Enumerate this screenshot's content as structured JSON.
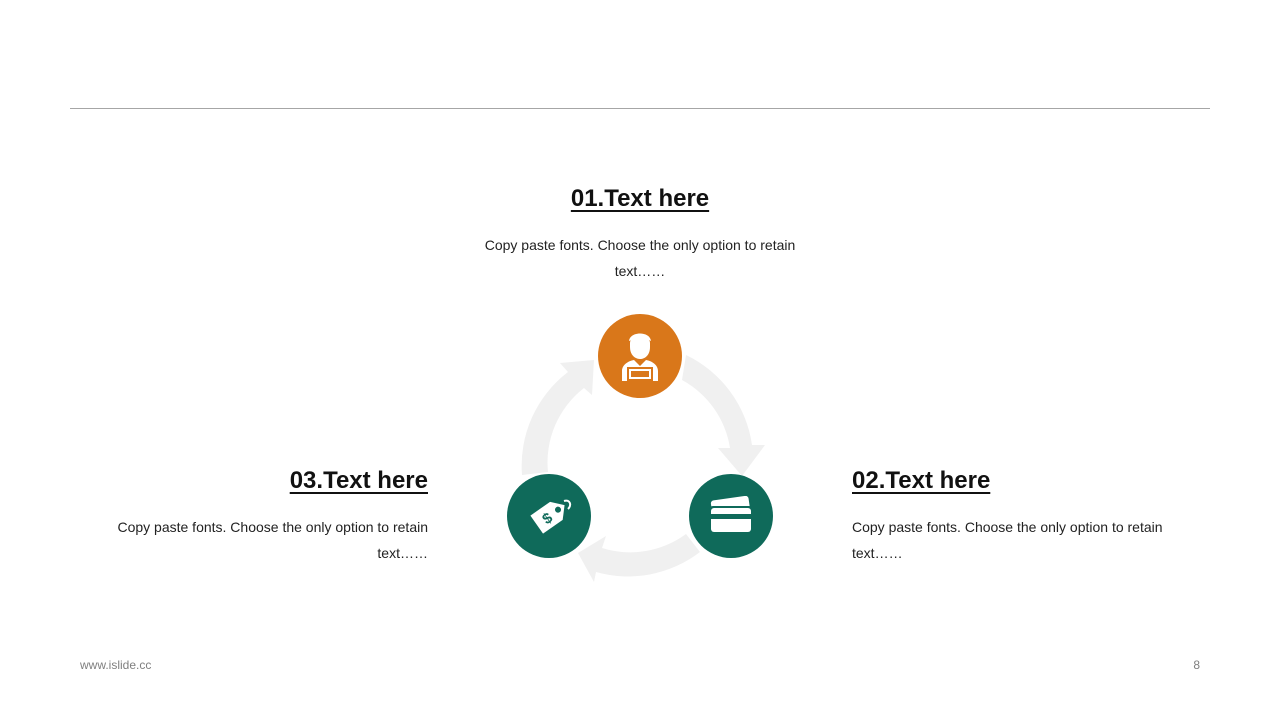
{
  "items": [
    {
      "title": "01.Text here",
      "body": "Copy paste fonts. Choose the only option to retain text……",
      "icon": "person-laptop-icon",
      "color": "#d9771a"
    },
    {
      "title": "02.Text here",
      "body": "Copy paste fonts. Choose the only option to retain text……",
      "icon": "credit-card-icon",
      "color": "#0f6a5a"
    },
    {
      "title": "03.Text here",
      "body": "Copy paste fonts. Choose the only option to retain text……",
      "icon": "price-tag-icon",
      "color": "#0f6a5a"
    }
  ],
  "footer": {
    "website": "www.islide.cc",
    "page_number": "8"
  },
  "colors": {
    "orange": "#d9771a",
    "green": "#0f6a5a",
    "arrow": "#f0f0f0"
  }
}
